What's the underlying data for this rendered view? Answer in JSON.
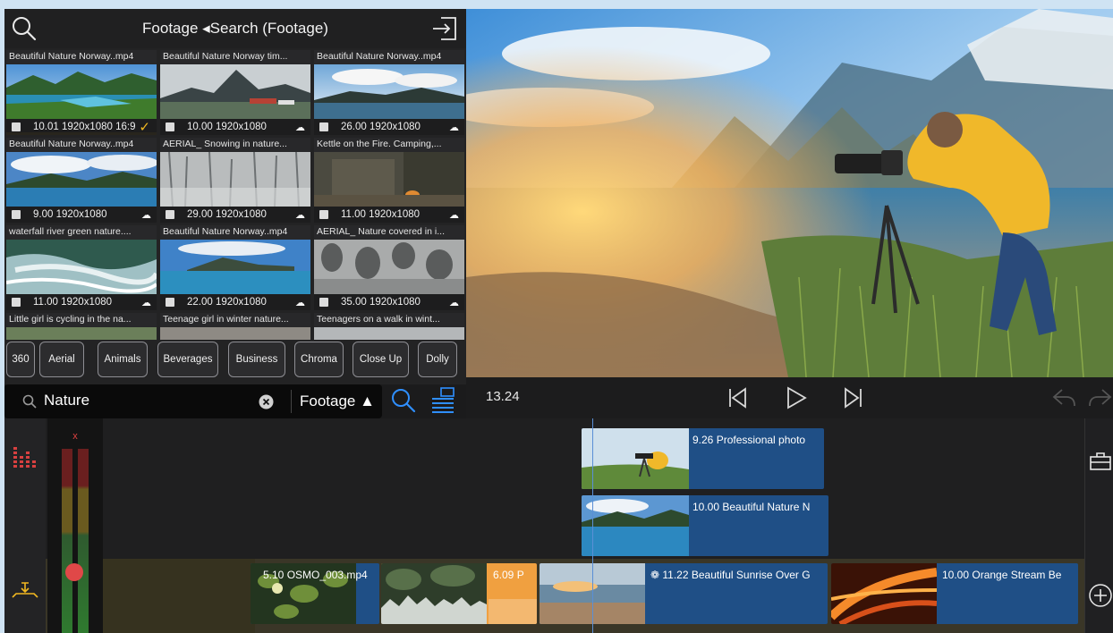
{
  "browser": {
    "title": "Footage ◂Search (Footage)",
    "icons": {
      "left": "search-icon",
      "right": "exit-icon"
    },
    "tiles": [
      {
        "title": "Beautiful Nature Norway..mp4",
        "meta": "10.01  1920x1080  16:9",
        "kind": "film",
        "status": "check",
        "selected": true,
        "thumb": "fjord-green"
      },
      {
        "title": "Beautiful Nature Norway tim...",
        "meta": "10.00  1920x1080",
        "kind": "timelapse",
        "status": "cloud",
        "thumb": "village-mountain"
      },
      {
        "title": "Beautiful Nature Norway..mp4",
        "meta": "26.00  1920x1080",
        "kind": "timelapse",
        "status": "cloud",
        "thumb": "lake-clouds"
      },
      {
        "title": "Beautiful Nature Norway..mp4",
        "meta": "9.00  1920x1080",
        "kind": "timelapse",
        "status": "cloud",
        "thumb": "fjord-blue"
      },
      {
        "title": "AERIAL_ Snowing in nature...",
        "meta": "29.00  1920x1080",
        "kind": "film",
        "status": "cloud",
        "thumb": "snow-forest"
      },
      {
        "title": "Kettle on the Fire. Camping,...",
        "meta": "11.00  1920x1080",
        "kind": "film",
        "status": "cloud",
        "thumb": "camp-forest"
      },
      {
        "title": "waterfall river green nature....",
        "meta": "11.00  1920x1080",
        "kind": "timelapse",
        "status": "cloud",
        "thumb": "waterfall"
      },
      {
        "title": "Beautiful Nature Norway..mp4",
        "meta": "22.00  1920x1080",
        "kind": "timelapse",
        "status": "cloud",
        "thumb": "lake-island"
      },
      {
        "title": "AERIAL_ Nature covered in i...",
        "meta": "35.00  1920x1080",
        "kind": "film",
        "status": "cloud",
        "thumb": "frost-trees"
      },
      {
        "title": "Little girl is cycling in the na...",
        "meta": "",
        "thumb": "cycling"
      },
      {
        "title": "Teenage girl in winter nature...",
        "meta": "",
        "thumb": "winter-girl"
      },
      {
        "title": "Teenagers on a walk in wint...",
        "meta": "",
        "thumb": "winter-walk"
      }
    ],
    "tags": [
      "360",
      "Aerial",
      "Animals",
      "Beverages",
      "Business",
      "Chroma",
      "Close Up",
      "Dolly"
    ]
  },
  "search": {
    "value": "Nature",
    "scope": "Footage ▲",
    "icons": [
      "search-icon",
      "clear-icon",
      "search-go-icon",
      "list-view-icon"
    ]
  },
  "transport": {
    "timecode": "13.24",
    "icons": [
      "skip-back-icon",
      "play-icon",
      "skip-forward-icon",
      "undo-icon",
      "redo-icon"
    ]
  },
  "timeline": {
    "meter_label": "x",
    "overlay_clips": [
      {
        "label": "9.26  Professional photo",
        "thumb": "photographer"
      },
      {
        "label": "10.00  Beautiful Nature N",
        "thumb": "fjord-blue"
      }
    ],
    "main_clips": [
      {
        "label": "5.10  OSMO_003.mp4",
        "thumb": "leaves",
        "color": "blue"
      },
      {
        "label": "6.09  P",
        "thumb": "forest-wave",
        "color": "orange"
      },
      {
        "label": "11.22  Beautiful Sunrise Over G",
        "thumb": "sunrise-beach",
        "color": "blue"
      },
      {
        "label": "10.00  Orange Stream Be",
        "thumb": "orange-stream",
        "color": "blue"
      }
    ],
    "icons": [
      "audio-mixer-icon",
      "insert-marker-icon",
      "toolbox-icon",
      "add-icon"
    ]
  },
  "colors": {
    "accent": "#f1b821",
    "clip_blue": "#1f4f86",
    "clip_orange": "#f0a040",
    "playhead": "#5a8fd6"
  }
}
